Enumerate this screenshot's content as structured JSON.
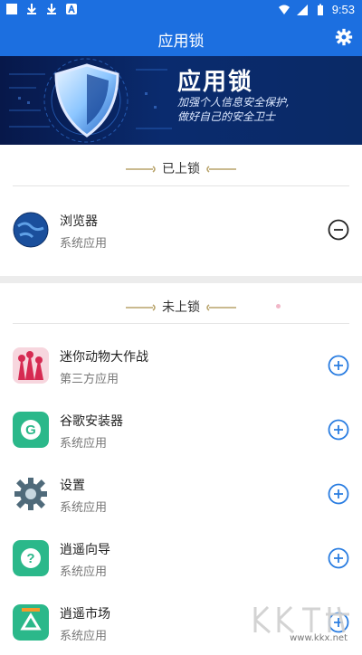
{
  "status_bar": {
    "time": "9:53"
  },
  "appbar": {
    "title": "应用锁"
  },
  "banner": {
    "title": "应用锁",
    "line1": "加强个人信息安全保护,",
    "line2": "做好自己的安全卫士"
  },
  "locked_section": {
    "title": "已上锁",
    "items": [
      {
        "name": "浏览器",
        "type": "系统应用",
        "icon": "globe-icon"
      }
    ]
  },
  "unlocked_section": {
    "title": "未上锁",
    "items": [
      {
        "name": "迷你动物大作战",
        "type": "第三方应用",
        "icon": "game-icon"
      },
      {
        "name": "谷歌安装器",
        "type": "系统应用",
        "icon": "google-installer-icon"
      },
      {
        "name": "设置",
        "type": "系统应用",
        "icon": "settings-gear-icon"
      },
      {
        "name": "逍遥向导",
        "type": "系统应用",
        "icon": "question-icon"
      },
      {
        "name": "逍遥市场",
        "type": "系统应用",
        "icon": "market-icon"
      }
    ]
  },
  "watermark": {
    "text": "www.kkx.net"
  },
  "colors": {
    "accent": "#1c6fe0",
    "action": "#2a7de1"
  }
}
